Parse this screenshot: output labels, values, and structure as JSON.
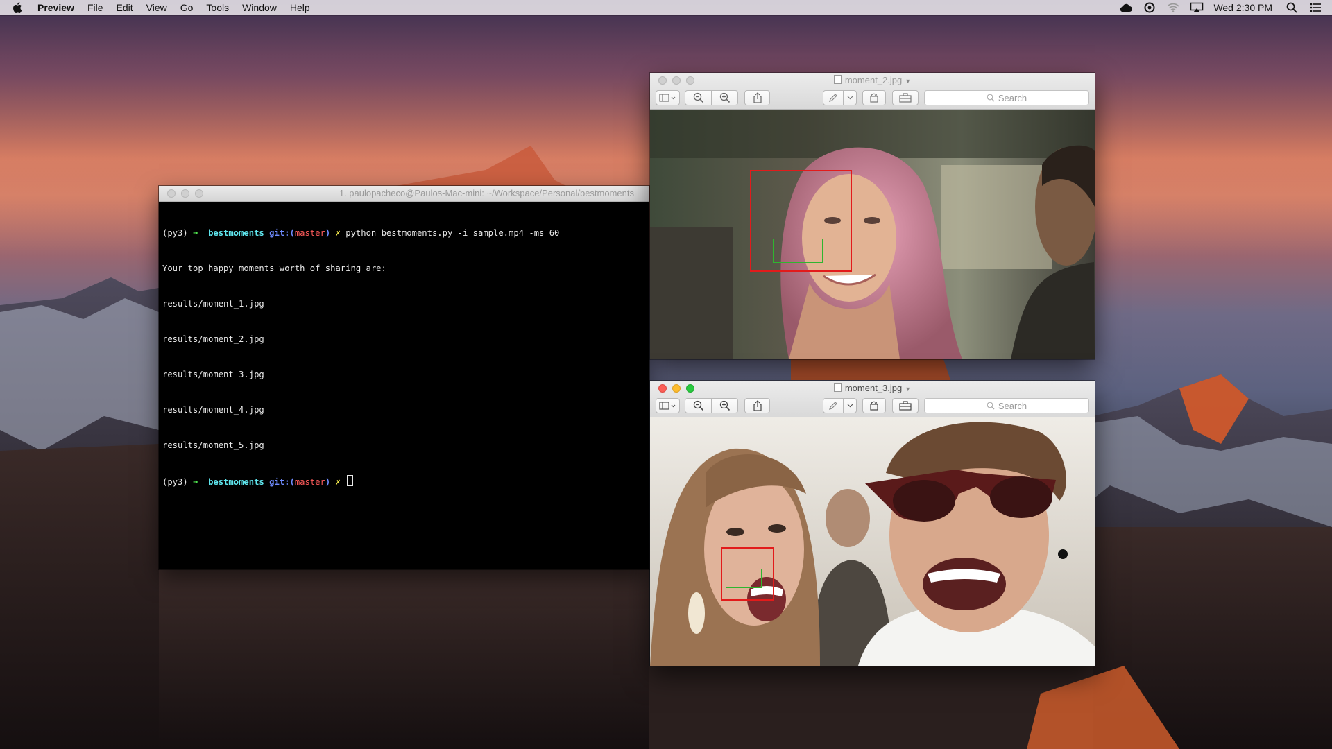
{
  "menubar": {
    "app_name": "Preview",
    "items": [
      "File",
      "Edit",
      "View",
      "Go",
      "Tools",
      "Window",
      "Help"
    ],
    "clock": "Wed 2:30 PM",
    "status_icons": [
      "creative-cloud-icon",
      "sync-icon",
      "wifi-icon",
      "airplay-icon",
      "spotlight-search-icon",
      "notification-center-icon"
    ]
  },
  "terminal": {
    "title": "1. paulopacheco@Paulos-Mac-mini: ~/Workspace/Personal/bestmoments",
    "prompt": {
      "env": "(py3)",
      "arrow": "➜",
      "dir": "bestmoments",
      "git_prefix": "git:(",
      "branch": "master",
      "git_suffix": ")",
      "dirty": "✗"
    },
    "command": "python bestmoments.py -i sample.mp4 -ms 60",
    "output": [
      "Your top happy moments worth of sharing are:",
      "results/moment_1.jpg",
      "results/moment_2.jpg",
      "results/moment_3.jpg",
      "results/moment_4.jpg",
      "results/moment_5.jpg"
    ]
  },
  "preview_windows": [
    {
      "title": "moment_2.jpg",
      "active": false,
      "search_placeholder": "Search"
    },
    {
      "title": "moment_3.jpg",
      "active": true,
      "search_placeholder": "Search"
    }
  ],
  "colors": {
    "detection_face": "#e21b1b",
    "detection_smile": "#2fb52f",
    "terminal_bg": "#000000"
  }
}
